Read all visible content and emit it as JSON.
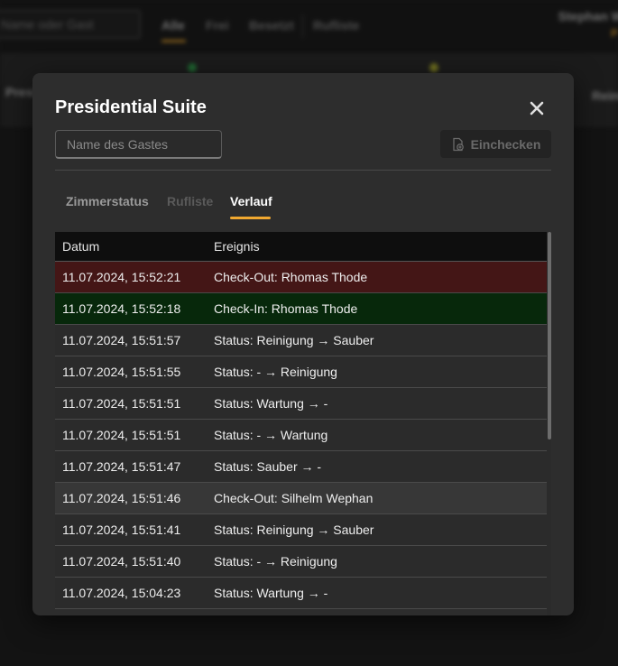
{
  "background": {
    "search_placeholder": "Name oder Gast",
    "tabs": [
      "Alle",
      "Frei",
      "Besetzt",
      "Rufliste"
    ],
    "user_name": "Stephan W",
    "user_sub": "P",
    "row_left": "Presi",
    "row_right": "Reinig"
  },
  "modal": {
    "title": "Presidential Suite",
    "guest_input_placeholder": "Name des Gastes",
    "checkin_label": "Einchecken",
    "tabs": {
      "zimmerstatus": "Zimmerstatus",
      "rufliste": "Rufliste",
      "verlauf": "Verlauf"
    },
    "table": {
      "headers": {
        "date": "Datum",
        "event": "Ereignis"
      },
      "rows": [
        {
          "date": "11.07.2024, 15:52:21",
          "event": "Check-Out: Rhomas Thode"
        },
        {
          "date": "11.07.2024, 15:52:18",
          "event": "Check-In: Rhomas Thode"
        },
        {
          "date": "11.07.2024, 15:51:57",
          "event": "Status: Reinigung → Sauber"
        },
        {
          "date": "11.07.2024, 15:51:55",
          "event": "Status: - → Reinigung"
        },
        {
          "date": "11.07.2024, 15:51:51",
          "event": "Status: Wartung → -"
        },
        {
          "date": "11.07.2024, 15:51:51",
          "event": "Status: - → Wartung"
        },
        {
          "date": "11.07.2024, 15:51:47",
          "event": "Status: Sauber → -"
        },
        {
          "date": "11.07.2024, 15:51:46",
          "event": "Check-Out: Silhelm Wephan"
        },
        {
          "date": "11.07.2024, 15:51:41",
          "event": "Status: Reinigung → Sauber"
        },
        {
          "date": "11.07.2024, 15:51:40",
          "event": "Status: - → Reinigung"
        },
        {
          "date": "11.07.2024, 15:04:23",
          "event": "Status: Wartung → -"
        }
      ]
    }
  },
  "colors": {
    "accent": "#f0a830",
    "checkout_row": "#441616",
    "checkin_row": "#07280b"
  }
}
